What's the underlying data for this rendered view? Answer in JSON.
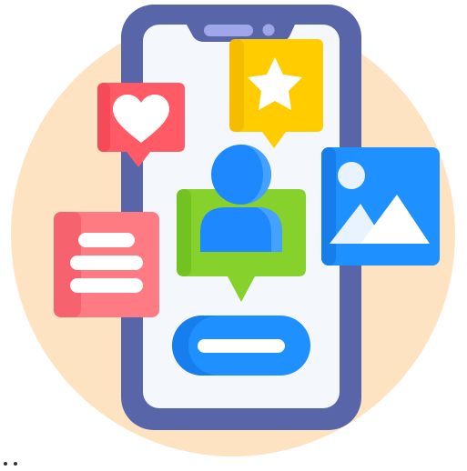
{
  "illustration": {
    "icons": [
      "heart-icon",
      "star-icon",
      "user-icon",
      "image-icon",
      "text-lines-icon",
      "pill-button-icon"
    ],
    "colors": {
      "background_circle": "#FDE3C2",
      "phone_frame": "#5865A9",
      "phone_screen": "#F4F7FB",
      "notch_pill": "#9FA7E8",
      "heart_card": "#FF5A66",
      "star_card": "#FFCC00",
      "user_card": "#86D12B",
      "user_figure": "#1E88FF",
      "image_card": "#1E90FF",
      "text_card": "#FF7B84",
      "pill_button": "#1E90FF",
      "white": "#FFFFFF"
    }
  }
}
